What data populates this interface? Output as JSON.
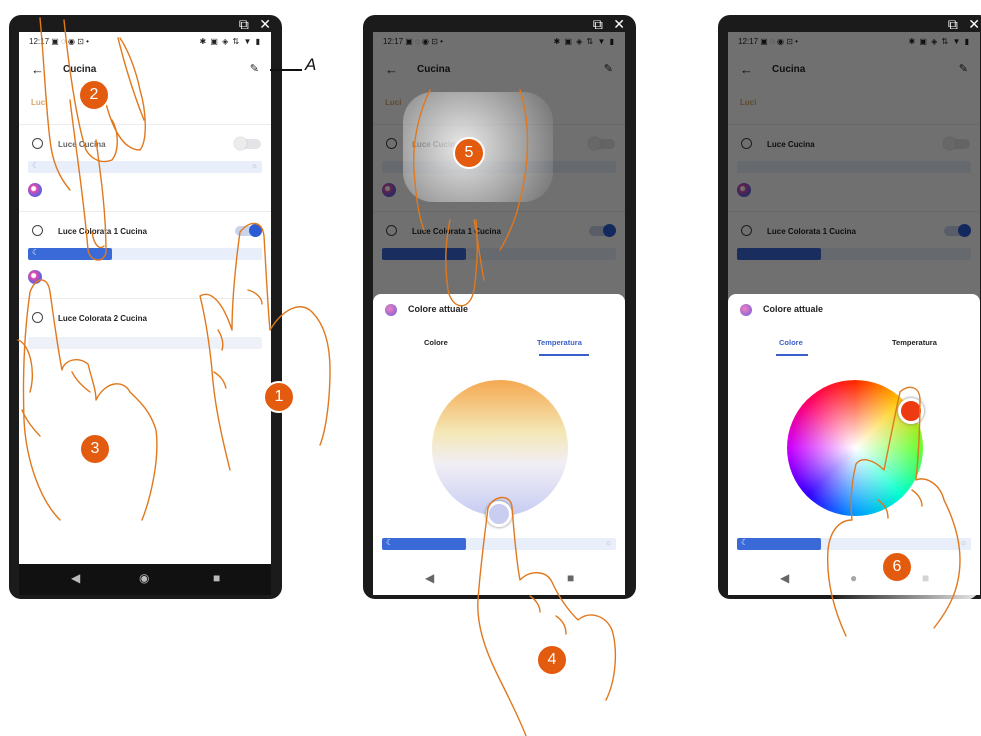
{
  "status_bar": {
    "time": "12:17",
    "left_icons": "▣ ◌ ◉ ⊡ •",
    "right_icons": "✱ ▣ ◈ ⇅ ▼ ▮"
  },
  "header": {
    "back_icon": "←",
    "title": "Cucina",
    "edit_icon": "✎"
  },
  "section_label": "Luci",
  "lights": [
    {
      "name": "Luce Cucina",
      "on": false,
      "brightness": 0
    },
    {
      "name": "Luce Colorata 1 Cucina",
      "on": true,
      "brightness": 0.36
    },
    {
      "name": "Luce Colorata 2 Cucina",
      "on": false,
      "brightness": 0
    }
  ],
  "sheet": {
    "title": "Colore attuale",
    "tab_color": "Colore",
    "tab_temperature": "Temperatura"
  },
  "nav": {
    "back": "◀",
    "home": "◉",
    "recent": "■",
    "home_dot": "●"
  },
  "window_icons": "⧉ ✕",
  "callouts": {
    "c1": "1",
    "c2": "2",
    "c3": "3",
    "c4": "4",
    "c5": "5",
    "c6": "6"
  },
  "annotation_letter": "A",
  "colors": {
    "accent_blue": "#3a6ad8",
    "callout_orange": "#e35b0f",
    "hand_line": "#e0781e"
  }
}
